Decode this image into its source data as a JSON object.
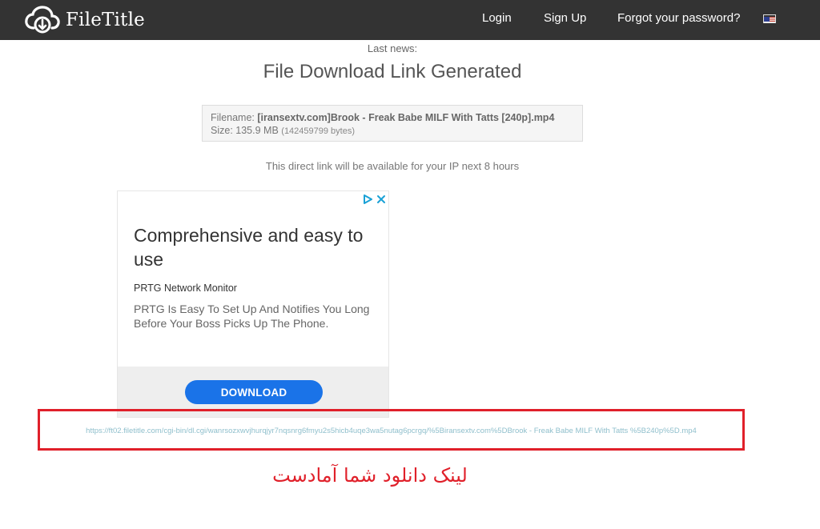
{
  "nav": {
    "logo_text": "FileTitle",
    "login": "Login",
    "signup": "Sign Up",
    "forgot_password": "Forgot your password?",
    "language_flag": "us-flag-icon"
  },
  "content": {
    "last_news": "Last news:",
    "title": "File Download Link Generated",
    "filename_label": "Filename:",
    "filename_value": "[iransextv.com]Brook - Freak Babe MILF With Tatts [240p].mp4",
    "size_label": "Size:",
    "size_value": "135.9 MB",
    "size_bytes": "(142459799 bytes)",
    "availability": "This direct link will be available for your IP next 8 hours"
  },
  "ad": {
    "headline": "Comprehensive and easy to use",
    "advertiser": "PRTG Network Monitor",
    "description": "PRTG Is Easy To Set Up And Notifies You Long Before Your Boss Picks Up The Phone.",
    "button": "DOWNLOAD",
    "controls_icons": [
      "adchoices-icon",
      "close-icon"
    ]
  },
  "download": {
    "direct_link": "https://ft02.filetitle.com/cgi-bin/dl.cgi/wanrsozxwvjhurqjyr7nqsnrg6fmyu2s5hicb4uqe3wa5nutag6pcrgq/%5Biransextv.com%5DBrook - Freak Babe MILF With Tatts %5B240p%5D.mp4",
    "caption": "لینک دانلود شما آمادست"
  },
  "colors": {
    "navbar": "#333333",
    "frame_red": "#e0202a",
    "ad_button_blue": "#1a73e8",
    "link_color": "#8fbfcc"
  }
}
